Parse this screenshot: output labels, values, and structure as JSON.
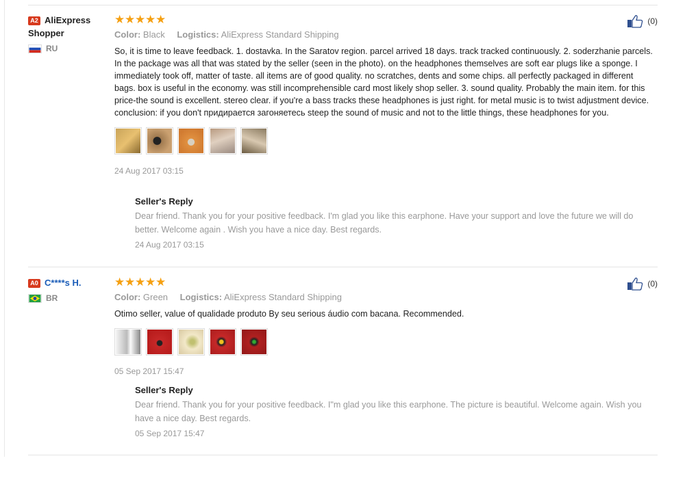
{
  "reviews": [
    {
      "level": "A2",
      "name": "AliExpress Shopper",
      "country": "RU",
      "rating": "★★★★★",
      "color_label": "Color:",
      "color_value": "Black",
      "logistics_label": "Logistics:",
      "logistics_value": "AliExpress Standard Shipping",
      "text": "So, it is time to leave feedback. 1. dostavka. In the Saratov region. parcel arrived 18 days. track tracked continuously. 2. soderzhanie parcels. In the package was all that was stated by the seller (seen in the photo). on the headphones themselves are soft ear plugs like a sponge. I immediately took off, matter of taste. all items are of good quality. no scratches, dents and some chips. all perfectly packaged in different bags. box is useful in the economy. was still incomprehensible card most likely shop seller. 3. sound quality. Probably the main item. for this price-the sound is excellent. stereo clear. if you're a bass tracks these headphones is just right. for metal music is to twist adjustment device. conclusion: if you don't придирается загоняетесь steep the sound of music and not to the little things, these headphones for you.",
      "date": "24 Aug 2017 03:15",
      "likes": "(0)",
      "reply_title": "Seller's Reply",
      "reply_text": "Dear friend. Thank you for your positive feedback. I'm glad you like this earphone. Have your support and love the future we will do better. Welcome again . Wish you have a nice day. Best regards.",
      "reply_date": "24 Aug 2017 03:15"
    },
    {
      "level": "A0",
      "name": "C****s H.",
      "country": "BR",
      "rating": "★★★★★",
      "color_label": "Color:",
      "color_value": "Green",
      "logistics_label": "Logistics:",
      "logistics_value": "AliExpress Standard Shipping",
      "text": "Otimo seller, value of qualidade produto By seu serious áudio com bacana. Recommended.",
      "date": "05 Sep 2017 15:47",
      "likes": "(0)",
      "reply_title": "Seller's Reply",
      "reply_text": "Dear friend. Thank you for your positive feedback. I\"m glad you like this earphone. The picture is beautiful. Welcome again. Wish you have a nice day. Best regards.",
      "reply_date": "05 Sep 2017 15:47"
    }
  ]
}
